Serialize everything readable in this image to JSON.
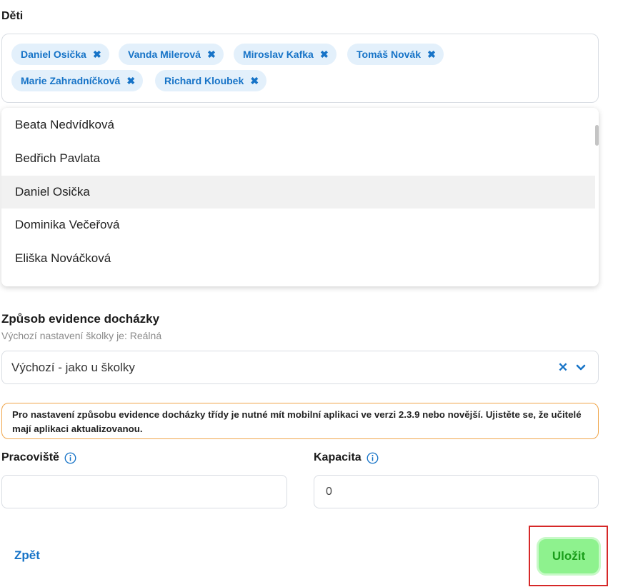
{
  "children": {
    "label": "Děti",
    "tags": [
      {
        "name": "Daniel Osička"
      },
      {
        "name": "Vanda Milerová"
      },
      {
        "name": "Miroslav Kafka"
      },
      {
        "name": "Tomáš Novák"
      },
      {
        "name": "Marie Zahradníčková"
      },
      {
        "name": "Richard Kloubek"
      }
    ],
    "options": [
      {
        "name": "Beata Nedvídková"
      },
      {
        "name": "Bedřich Pavlata"
      },
      {
        "name": "Daniel Osička",
        "highlighted": true
      },
      {
        "name": "Dominika Večeřová"
      },
      {
        "name": "Eliška Nováčková"
      }
    ]
  },
  "attendance": {
    "label": "Způsob evidence docházky",
    "hint": "Výchozí nastavení školky je: Reálná",
    "selected": "Výchozí - jako u školky",
    "clear_icon": "close-icon",
    "arrow_icon": "chevron-down-icon"
  },
  "warning": {
    "text": "Pro nastavení způsobu evidence docházky třídy je nutné mít mobilní aplikaci ve verzi 2.3.9 nebo novější. Ujistěte se, že učitelé mají aplikaci aktualizovanou."
  },
  "workplace": {
    "label": "Pracoviště",
    "value": "",
    "icon": "info-icon"
  },
  "capacity": {
    "label": "Kapacita",
    "value": "0",
    "icon": "info-icon"
  },
  "actions": {
    "back_label": "Zpět",
    "save_label": "Uložit"
  },
  "colors": {
    "accent": "#1673c7",
    "tag_bg": "#e3f0fb",
    "save_bg": "#8ef28e",
    "save_text": "#1b9e1b",
    "warning_border": "#f0a54a",
    "highlight_frame": "#d62828"
  }
}
